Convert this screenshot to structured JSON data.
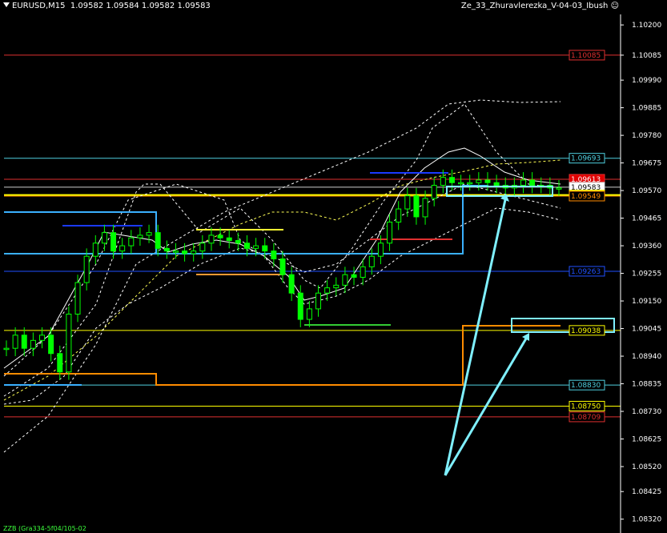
{
  "header": {
    "symbol": "EURUSD,M15",
    "ohlc": "1.09582 1.09584 1.09582 1.09583",
    "expert": "Ze_33_Zhuravlerezka_V-04-03_Ibush",
    "expert_icon": "smiley-icon"
  },
  "indicator_label": "ZZB (Gra334-5f04/105-02",
  "colors": {
    "background": "#000000",
    "candle": "#00ff00",
    "axis": "#ffffff"
  },
  "chart_data": {
    "type": "candlestick",
    "ylim": [
      1.0831,
      1.1024
    ],
    "y_ticks": [
      "1.10200",
      "1.10085",
      "1.09990",
      "1.09885",
      "1.09780",
      "1.09675",
      "1.09570",
      "1.09465",
      "1.09360",
      "1.09255",
      "1.09150",
      "1.09045",
      "1.08940",
      "1.08835",
      "1.08730",
      "1.08625",
      "1.08520",
      "1.08425",
      "1.08320"
    ],
    "price_series": [
      1.0897,
      1.0902,
      1.0897,
      1.09,
      1.0902,
      1.0895,
      1.0888,
      1.091,
      1.0922,
      1.0932,
      1.0937,
      1.0941,
      1.0934,
      1.0936,
      1.0939,
      1.094,
      1.0941,
      1.0935,
      1.0934,
      1.0934,
      1.0933,
      1.0934,
      1.0937,
      1.094,
      1.0939,
      1.0938,
      1.0937,
      1.0935,
      1.0936,
      1.0934,
      1.0931,
      1.0925,
      1.0918,
      1.0908,
      1.0912,
      1.0918,
      1.092,
      1.0921,
      1.0925,
      1.0924,
      1.0928,
      1.0932,
      1.0937,
      1.0945,
      1.095,
      1.0955,
      1.0947,
      1.0954,
      1.0959,
      1.0962,
      1.096,
      1.096,
      1.096,
      1.0961,
      1.096,
      1.0959,
      1.0958,
      1.0959,
      1.0961,
      1.0959,
      1.0959,
      1.0958,
      1.0958
    ],
    "price_levels": [
      {
        "value": 1.10085,
        "label": "1.10085",
        "color": "#e03030",
        "text_color": "#e03030",
        "box_fill": "#000000"
      },
      {
        "value": 1.09693,
        "label": "1.09693",
        "color": "#4fd0e0",
        "text_color": "#4fd0e0",
        "box_fill": "#000000"
      },
      {
        "value": 1.09613,
        "label": "1.09613",
        "color": "#e03030",
        "text_color": "#ffffff",
        "box_fill": "#e00000"
      },
      {
        "value": 1.09583,
        "label": "1.09583",
        "color": "#cccccc",
        "text_color": "#000000",
        "box_fill": "#ffffff"
      },
      {
        "value": 1.09553,
        "label": "1.09553",
        "color": "#ffff00",
        "text_color": "#000000",
        "box_fill": "#ffff00"
      },
      {
        "value": 1.09549,
        "label": "1.09549",
        "color": "#ff8c00",
        "text_color": "#ff8c00",
        "box_fill": "#000000"
      },
      {
        "value": 1.09263,
        "label": "1.09263",
        "color": "#2050ff",
        "text_color": "#2050ff",
        "box_fill": "#000000"
      },
      {
        "value": 1.09038,
        "label": "1.09038",
        "color": "#ffff00",
        "text_color": "#ffff00",
        "box_fill": "#000000"
      },
      {
        "value": 1.0883,
        "label": "1.08830",
        "color": "#4fd0e0",
        "text_color": "#4fd0e0",
        "box_fill": "#000000"
      },
      {
        "value": 1.0875,
        "label": "1.08750",
        "color": "#ffff00",
        "text_color": "#ffff00",
        "box_fill": "#000000"
      },
      {
        "value": 1.08709,
        "label": "1.08709",
        "color": "#e03030",
        "text_color": "#e03030",
        "box_fill": "#000000"
      }
    ],
    "grid": false
  }
}
